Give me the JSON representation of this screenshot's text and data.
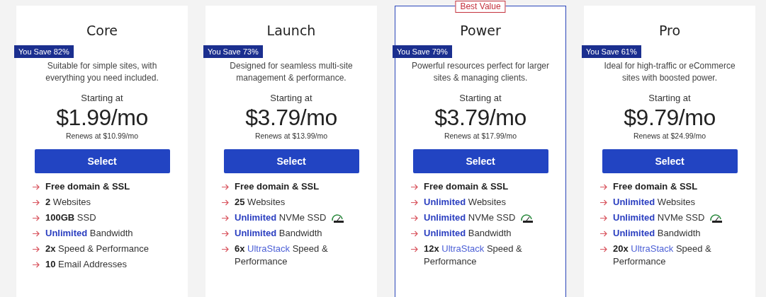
{
  "plans": [
    {
      "name": "Core",
      "featured": false,
      "savings": "You Save 82%",
      "description": "Suitable for simple sites, with everything you need included.",
      "starting": "Starting at",
      "price": "$1.99/mo",
      "renews": "Renews at $10.99/mo",
      "button": "Select",
      "features": [
        {
          "speed_icon": false,
          "parts": [
            {
              "text": "Free domain & SSL",
              "kind": "bold"
            }
          ]
        },
        {
          "speed_icon": false,
          "parts": [
            {
              "text": "2",
              "kind": "bold"
            },
            {
              "text": "Websites",
              "kind": "plain"
            }
          ]
        },
        {
          "speed_icon": false,
          "parts": [
            {
              "text": "100GB",
              "kind": "bold"
            },
            {
              "text": "SSD",
              "kind": "plain"
            }
          ]
        },
        {
          "speed_icon": false,
          "parts": [
            {
              "text": "Unlimited",
              "kind": "highlight"
            },
            {
              "text": "Bandwidth",
              "kind": "plain"
            }
          ]
        },
        {
          "speed_icon": false,
          "parts": [
            {
              "text": "2x",
              "kind": "bold"
            },
            {
              "text": "Speed & Performance",
              "kind": "plain"
            }
          ]
        },
        {
          "speed_icon": false,
          "parts": [
            {
              "text": "10",
              "kind": "bold"
            },
            {
              "text": "Email Addresses",
              "kind": "plain"
            }
          ]
        }
      ]
    },
    {
      "name": "Launch",
      "featured": false,
      "savings": "You Save 73%",
      "description": "Designed for seamless multi-site management & performance.",
      "starting": "Starting at",
      "price": "$3.79/mo",
      "renews": "Renews at $13.99/mo",
      "button": "Select",
      "features": [
        {
          "speed_icon": false,
          "parts": [
            {
              "text": "Free domain & SSL",
              "kind": "bold"
            }
          ]
        },
        {
          "speed_icon": false,
          "parts": [
            {
              "text": "25",
              "kind": "bold"
            },
            {
              "text": "Websites",
              "kind": "plain"
            }
          ]
        },
        {
          "speed_icon": true,
          "parts": [
            {
              "text": "Unlimited",
              "kind": "highlight"
            },
            {
              "text": "NVMe SSD",
              "kind": "plain"
            }
          ]
        },
        {
          "speed_icon": false,
          "parts": [
            {
              "text": "Unlimited",
              "kind": "highlight"
            },
            {
              "text": "Bandwidth",
              "kind": "plain"
            }
          ]
        },
        {
          "speed_icon": false,
          "parts": [
            {
              "text": "6x",
              "kind": "bold"
            },
            {
              "text": "UltraStack",
              "kind": "accent"
            },
            {
              "text": "Speed & Performance",
              "kind": "plain"
            }
          ]
        }
      ]
    },
    {
      "name": "Power",
      "featured": true,
      "tag": "Best Value",
      "savings": "You Save 79%",
      "description": "Powerful resources perfect for larger sites & managing clients.",
      "starting": "Starting at",
      "price": "$3.79/mo",
      "renews": "Renews at $17.99/mo",
      "button": "Select",
      "features": [
        {
          "speed_icon": false,
          "parts": [
            {
              "text": "Free domain & SSL",
              "kind": "bold"
            }
          ]
        },
        {
          "speed_icon": false,
          "parts": [
            {
              "text": "Unlimited",
              "kind": "highlight"
            },
            {
              "text": "Websites",
              "kind": "plain"
            }
          ]
        },
        {
          "speed_icon": true,
          "parts": [
            {
              "text": "Unlimited",
              "kind": "highlight"
            },
            {
              "text": "NVMe SSD",
              "kind": "plain"
            }
          ]
        },
        {
          "speed_icon": false,
          "parts": [
            {
              "text": "Unlimited",
              "kind": "highlight"
            },
            {
              "text": "Bandwidth",
              "kind": "plain"
            }
          ]
        },
        {
          "speed_icon": false,
          "parts": [
            {
              "text": "12x",
              "kind": "bold"
            },
            {
              "text": "UltraStack",
              "kind": "accent"
            },
            {
              "text": "Speed & Performance",
              "kind": "plain"
            }
          ]
        }
      ]
    },
    {
      "name": "Pro",
      "featured": false,
      "savings": "You Save 61%",
      "description": "Ideal for high-traffic or eCommerce sites with boosted power.",
      "starting": "Starting at",
      "price": "$9.79/mo",
      "renews": "Renews at $24.99/mo",
      "button": "Select",
      "features": [
        {
          "speed_icon": false,
          "parts": [
            {
              "text": "Free domain & SSL",
              "kind": "bold"
            }
          ]
        },
        {
          "speed_icon": false,
          "parts": [
            {
              "text": "Unlimited",
              "kind": "highlight"
            },
            {
              "text": "Websites",
              "kind": "plain"
            }
          ]
        },
        {
          "speed_icon": true,
          "parts": [
            {
              "text": "Unlimited",
              "kind": "highlight"
            },
            {
              "text": "NVMe SSD",
              "kind": "plain"
            }
          ]
        },
        {
          "speed_icon": false,
          "parts": [
            {
              "text": "Unlimited",
              "kind": "highlight"
            },
            {
              "text": "Bandwidth",
              "kind": "plain"
            }
          ]
        },
        {
          "speed_icon": false,
          "parts": [
            {
              "text": "20x",
              "kind": "bold"
            },
            {
              "text": "UltraStack",
              "kind": "accent"
            },
            {
              "text": "Speed & Performance",
              "kind": "plain"
            }
          ]
        }
      ]
    }
  ]
}
